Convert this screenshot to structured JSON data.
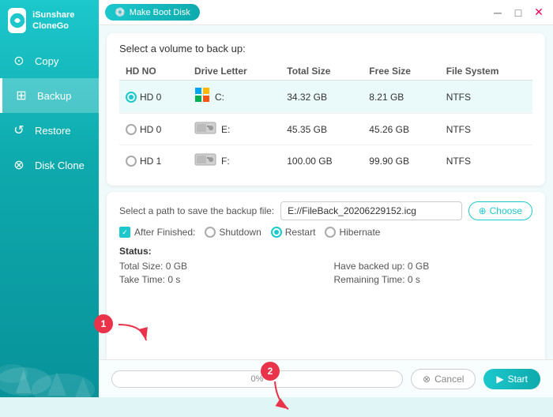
{
  "app": {
    "name": "iSunshare CloneGo",
    "logo_char": "S"
  },
  "titlebar": {
    "make_boot_btn": "Make Boot Disk",
    "minimize": "─",
    "maximize": "□",
    "close": "✕"
  },
  "sidebar": {
    "items": [
      {
        "id": "copy",
        "label": "Copy",
        "icon": "⊙"
      },
      {
        "id": "backup",
        "label": "Backup",
        "icon": "⊞",
        "active": true
      },
      {
        "id": "restore",
        "label": "Restore",
        "icon": "↺"
      },
      {
        "id": "disk-clone",
        "label": "Disk Clone",
        "icon": "⊗"
      }
    ]
  },
  "volume_panel": {
    "title": "Select a volume to back up:",
    "columns": [
      "HD NO",
      "Drive Letter",
      "Total Size",
      "Free Size",
      "File System"
    ],
    "rows": [
      {
        "hd": "HD 0",
        "letter": "C:",
        "total": "34.32 GB",
        "free": "8.21 GB",
        "fs": "NTFS",
        "selected": true,
        "icon": "windows"
      },
      {
        "hd": "HD 0",
        "letter": "E:",
        "total": "45.35 GB",
        "free": "45.26 GB",
        "fs": "NTFS",
        "selected": false,
        "icon": "hdd"
      },
      {
        "hd": "HD 1",
        "letter": "F:",
        "total": "100.00 GB",
        "free": "99.90 GB",
        "fs": "NTFS",
        "selected": false,
        "icon": "hdd"
      }
    ]
  },
  "backup_panel": {
    "path_label": "Select a path to save the backup file:",
    "path_value": "E://FileBack_20206229152.icg",
    "choose_label": "Choose",
    "after_finished_label": "After Finished:",
    "options": [
      {
        "id": "shutdown",
        "label": "Shutdown",
        "selected": false
      },
      {
        "id": "restart",
        "label": "Restart",
        "selected": true
      },
      {
        "id": "hibernate",
        "label": "Hibernate",
        "selected": false
      }
    ],
    "status": {
      "title": "Status:",
      "total_size_label": "Total Size: 0 GB",
      "take_time_label": "Take Time: 0 s",
      "have_backed_label": "Have backed up: 0 GB",
      "remaining_label": "Remaining Time: 0 s"
    }
  },
  "footer": {
    "progress_percent": "0%",
    "cancel_label": "Cancel",
    "start_label": "Start"
  },
  "annotations": [
    {
      "id": "1",
      "label": "1"
    },
    {
      "id": "2",
      "label": "2"
    }
  ]
}
